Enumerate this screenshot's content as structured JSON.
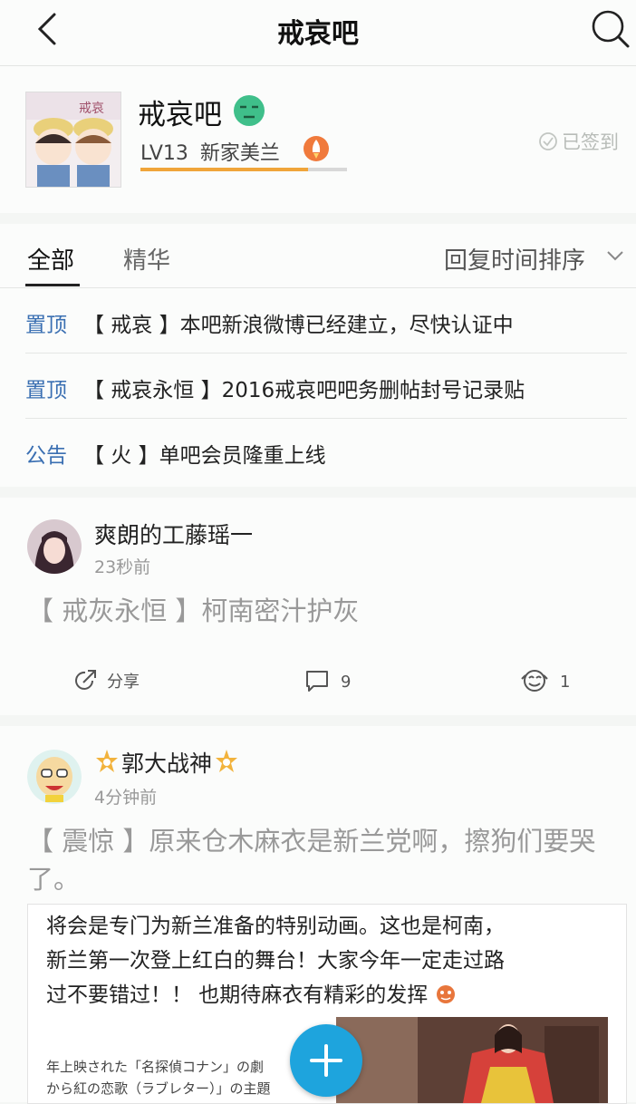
{
  "header": {
    "title": "戒哀吧"
  },
  "forum": {
    "name": "戒哀吧",
    "level": "LV13",
    "level_title": "新家美兰",
    "level_progress": 0.81,
    "sign_status": "已签到"
  },
  "tabs": {
    "all": "全部",
    "essence": "精华",
    "sort": "回复时间排序"
  },
  "pinned": [
    {
      "tag": "置顶",
      "text": "【 戒哀 】本吧新浪微博已经建立，尽快认证中"
    },
    {
      "tag": "置顶",
      "text": "【 戒哀永恒 】2016戒哀吧吧务删帖封号记录贴"
    },
    {
      "tag": "公告",
      "text": "【 火 】单吧会员隆重上线"
    }
  ],
  "posts": [
    {
      "author": "爽朗的工藤瑶一",
      "time": "23秒前",
      "title": "【 戒灰永恒 】柯南密汁护灰",
      "share_label": "分享",
      "comments": "9",
      "likes": "1"
    },
    {
      "author": "郭大战神",
      "time": "4分钟前",
      "title": "【 震惊 】原来仓木麻衣是新兰党啊，擦狗们要哭了。",
      "preview_lines": [
        "将会是专门为新兰准备的特别动画。这也是柯南，",
        "新兰第一次登上红白的舞台！大家今年一定走过路",
        "过不要错过！！ 也期待麻衣有精彩的发挥"
      ],
      "preview_jp_lines": [
        "年上映された「名探偵コナン」の劇",
        "から紅の恋歌（ラブレター）」の主題"
      ]
    }
  ],
  "colors": {
    "accent_blue": "#3a6fb2",
    "fab_blue": "#1ea4dd",
    "progress_orange": "#f0a53a",
    "level_icon_orange": "#f07a3c",
    "badge_green": "#3fbf8a"
  },
  "icons": {
    "back": "back-arrow-icon",
    "search": "search-icon",
    "share": "share-icon",
    "comment": "comment-icon",
    "like": "like-icon",
    "add": "plus-icon"
  }
}
